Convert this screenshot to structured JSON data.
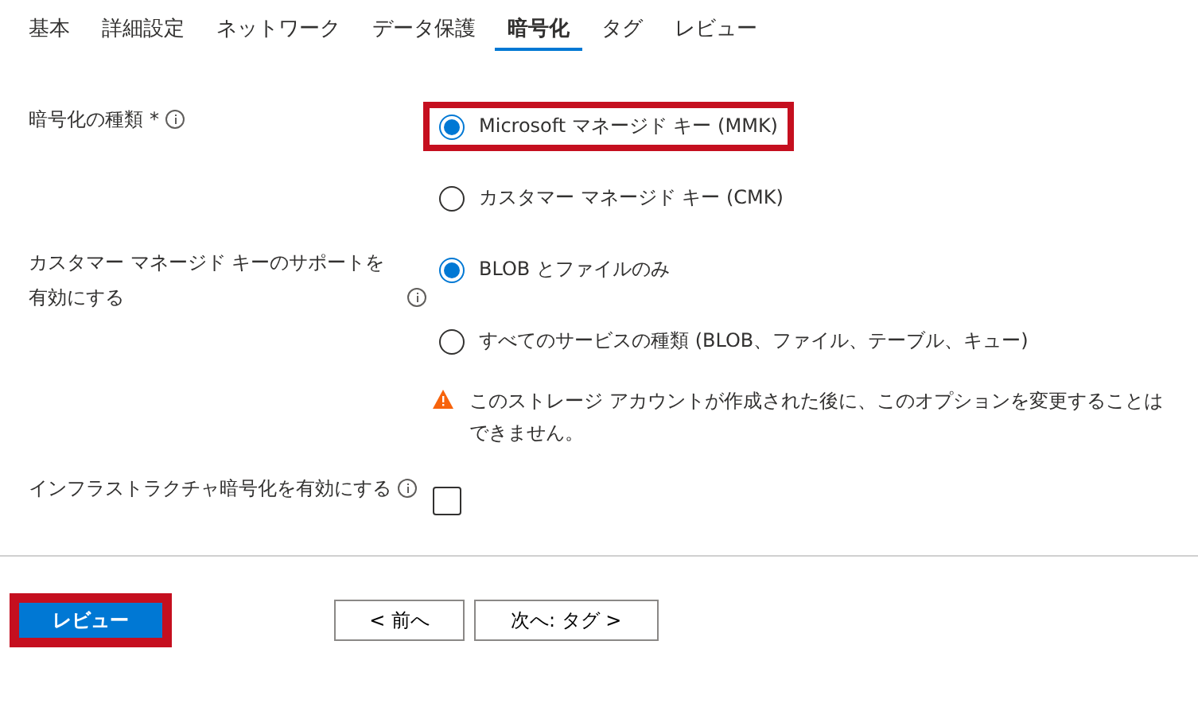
{
  "tabs": [
    {
      "label": "基本",
      "selected": false
    },
    {
      "label": "詳細設定",
      "selected": false
    },
    {
      "label": "ネットワーク",
      "selected": false
    },
    {
      "label": "データ保護",
      "selected": false
    },
    {
      "label": "暗号化",
      "selected": true
    },
    {
      "label": "タグ",
      "selected": false
    },
    {
      "label": "レビュー",
      "selected": false
    }
  ],
  "fields": [
    {
      "kind": "radio",
      "label": "暗号化の種類",
      "required_mark": "*",
      "options": [
        {
          "label": "Microsoft マネージド キー (MMK)",
          "selected": true,
          "highlighted": true
        },
        {
          "label": "カスタマー マネージド キー (CMK)",
          "selected": false,
          "highlighted": false
        }
      ]
    },
    {
      "kind": "radio",
      "label": "カスタマー マネージド キーのサポートを有効にする",
      "options": [
        {
          "label": "BLOB とファイルのみ",
          "selected": true,
          "highlighted": false
        },
        {
          "label": "すべてのサービスの種類 (BLOB、ファイル、テーブル、キュー)",
          "selected": false,
          "highlighted": false
        }
      ],
      "warning": "このストレージ アカウントが作成された後に、このオプションを変更することはできません。"
    },
    {
      "kind": "checkbox",
      "label": "インフラストラクチャ暗号化を有効にする",
      "checked": false
    }
  ],
  "footer": {
    "primary": {
      "label": "レビュー",
      "highlighted": true
    },
    "buttons": [
      "< 前へ",
      "次へ: タグ >"
    ]
  }
}
